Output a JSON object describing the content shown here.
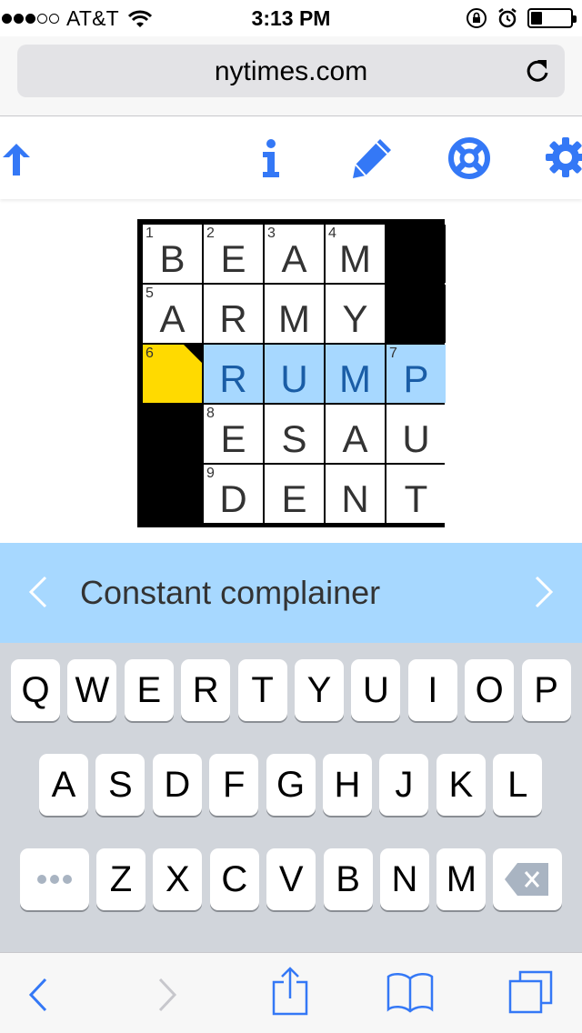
{
  "status_bar": {
    "carrier": "AT&T",
    "time": "3:13 PM"
  },
  "browser": {
    "url": "nytimes.com"
  },
  "toolbar": {
    "icons": [
      "arrow-up-icon",
      "info-icon",
      "pencil-icon",
      "lifebuoy-icon",
      "gear-icon"
    ]
  },
  "puzzle": {
    "rows": [
      [
        {
          "n": "1",
          "l": "B"
        },
        {
          "n": "2",
          "l": "E"
        },
        {
          "n": "3",
          "l": "A"
        },
        {
          "n": "4",
          "l": "M"
        },
        {
          "black": true
        }
      ],
      [
        {
          "n": "5",
          "l": "A"
        },
        {
          "n": "",
          "l": "R"
        },
        {
          "n": "",
          "l": "M"
        },
        {
          "n": "",
          "l": "Y"
        },
        {
          "black": true
        }
      ],
      [
        {
          "n": "6",
          "l": "",
          "sel": true
        },
        {
          "n": "",
          "l": "R",
          "hl": true
        },
        {
          "n": "",
          "l": "U",
          "hl": true
        },
        {
          "n": "",
          "l": "M",
          "hl": true
        },
        {
          "n": "7",
          "l": "P",
          "hl": true
        }
      ],
      [
        {
          "black": true
        },
        {
          "n": "8",
          "l": "E"
        },
        {
          "n": "",
          "l": "S"
        },
        {
          "n": "",
          "l": "A"
        },
        {
          "n": "",
          "l": "U"
        }
      ],
      [
        {
          "black": true
        },
        {
          "n": "9",
          "l": "D"
        },
        {
          "n": "",
          "l": "E"
        },
        {
          "n": "",
          "l": "N"
        },
        {
          "n": "",
          "l": "T"
        }
      ]
    ]
  },
  "clue": {
    "text": "Constant complainer"
  },
  "keyboard": {
    "row1": [
      "Q",
      "W",
      "E",
      "R",
      "T",
      "Y",
      "U",
      "I",
      "O",
      "P"
    ],
    "row2": [
      "A",
      "S",
      "D",
      "F",
      "G",
      "H",
      "J",
      "K",
      "L"
    ],
    "row3": [
      "Z",
      "X",
      "C",
      "V",
      "B",
      "N",
      "M"
    ]
  },
  "colors": {
    "accent": "#3478f6",
    "highlight": "#a7d8ff",
    "selected": "#ffda00"
  }
}
